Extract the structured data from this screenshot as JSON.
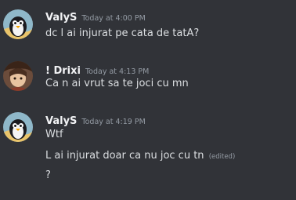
{
  "messages": [
    {
      "author": "ValyS",
      "timestamp": "Today at 4:00 PM",
      "avatar_icon": "penguin-avatar-icon",
      "lines": [
        "dc l ai injurat pe cata de tatA?"
      ]
    },
    {
      "author": "! Drixi",
      "timestamp": "Today at 4:13 PM",
      "avatar_icon": "anime-character-avatar-icon",
      "lines": [
        "Ca n ai vrut sa te joci cu mn"
      ]
    },
    {
      "author": "ValyS",
      "timestamp": "Today at 4:19 PM",
      "avatar_icon": "penguin-avatar-icon",
      "lines": [
        "Wtf",
        "L ai injurat doar ca nu joc cu tn",
        "?"
      ],
      "edited_label": "(edited)"
    }
  ],
  "colors": {
    "background": "#313338",
    "username": "#f2f3f5",
    "text": "#dbdee1",
    "muted": "#949ba4"
  }
}
